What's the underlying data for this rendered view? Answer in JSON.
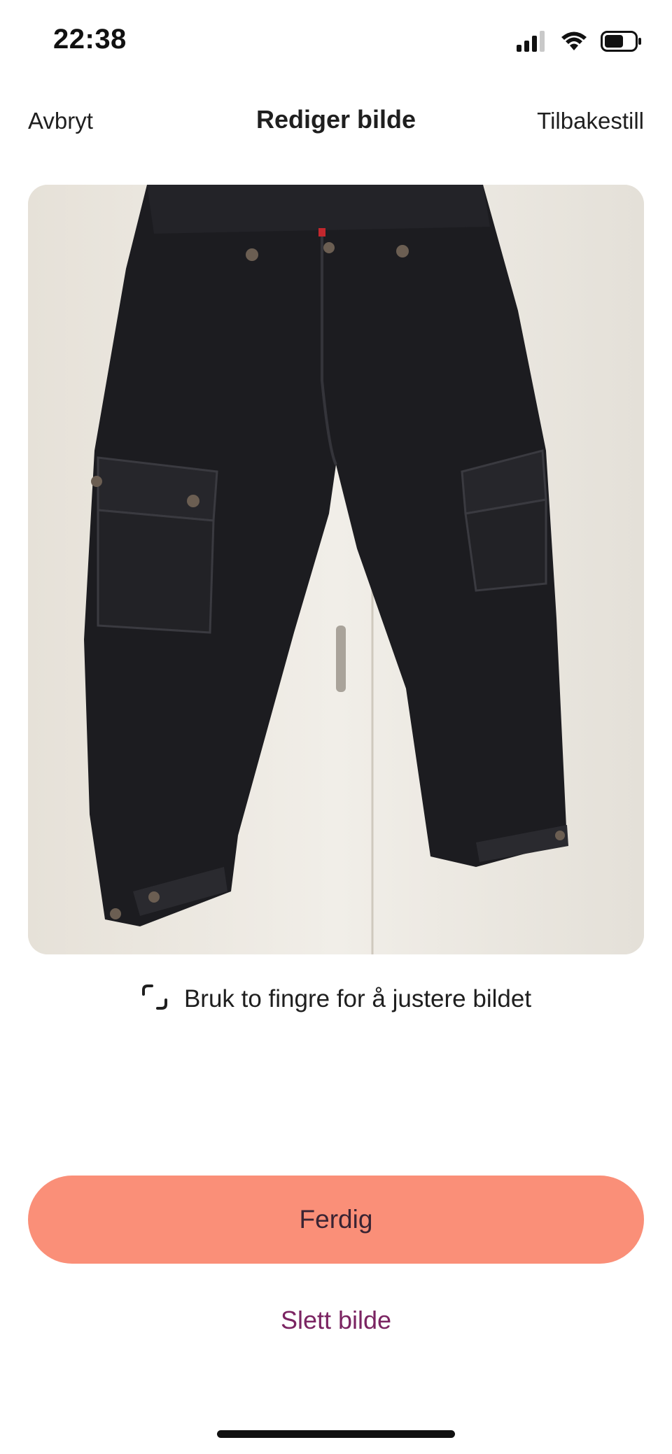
{
  "status_bar": {
    "time": "22:38",
    "icons": [
      "cellular-signal-icon",
      "wifi-icon",
      "battery-icon"
    ]
  },
  "nav": {
    "cancel_label": "Avbryt",
    "title": "Rediger bilde",
    "reset_label": "Tilbakestill"
  },
  "image": {
    "subject": "black-cargo-pants-photo"
  },
  "hint": {
    "icon": "crop-corners-icon",
    "text": "Bruk to fingre for å justere bildet"
  },
  "actions": {
    "done_label": "Ferdig",
    "delete_label": "Slett bilde"
  },
  "colors": {
    "done_button": "#fa8f78",
    "delete_text": "#7b2462"
  }
}
